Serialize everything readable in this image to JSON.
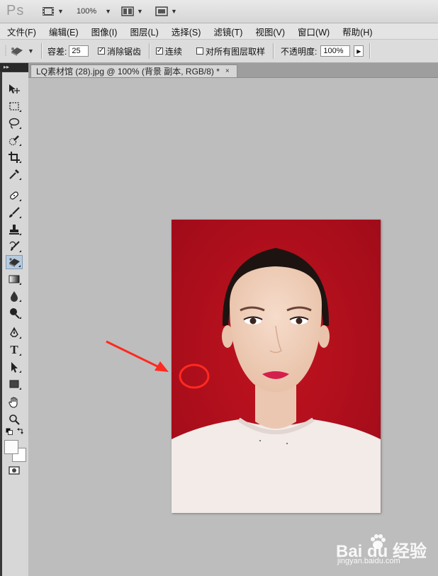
{
  "app": {
    "logo": "Ps",
    "zoom_label": "100%"
  },
  "menubar": {
    "items": [
      "文件(F)",
      "编辑(E)",
      "图像(I)",
      "图层(L)",
      "选择(S)",
      "滤镜(T)",
      "视图(V)",
      "窗口(W)",
      "帮助(H)"
    ]
  },
  "options": {
    "tolerance_label": "容差:",
    "tolerance_value": "25",
    "antialias_label": "消除锯齿",
    "antialias_checked": "✓",
    "contiguous_label": "连续",
    "contiguous_checked": "✓",
    "all_layers_label": "对所有图层取样",
    "opacity_label": "不透明度:",
    "opacity_value": "100%"
  },
  "document": {
    "tab_title": "LQ素材馆 (28).jpg @ 100% (背景 副本, RGB/8) *",
    "tab_close": "×"
  },
  "colors": {
    "annotation_red": "#ff2a1f",
    "photo_background": "#b00e1c",
    "active_tool_bg": "#b7cbe0"
  },
  "tools": [
    {
      "name": "move-tool-icon"
    },
    {
      "name": "marquee-tool-icon"
    },
    {
      "name": "lasso-tool-icon"
    },
    {
      "name": "quick-selection-tool-icon"
    },
    {
      "name": "crop-tool-icon"
    },
    {
      "name": "eyedropper-tool-icon"
    },
    {
      "name": "healing-brush-tool-icon"
    },
    {
      "name": "brush-tool-icon"
    },
    {
      "name": "clone-stamp-tool-icon"
    },
    {
      "name": "history-brush-tool-icon"
    },
    {
      "name": "background-eraser-tool-icon"
    },
    {
      "name": "gradient-tool-icon"
    },
    {
      "name": "blur-tool-icon"
    },
    {
      "name": "dodge-tool-icon"
    },
    {
      "name": "pen-tool-icon"
    },
    {
      "name": "type-tool-icon"
    },
    {
      "name": "path-selection-tool-icon"
    },
    {
      "name": "rectangle-tool-icon"
    },
    {
      "name": "hand-tool-icon"
    },
    {
      "name": "zoom-tool-icon"
    }
  ],
  "watermark": {
    "brand": "Bai du 经验",
    "url": "jingyan.baidu.com"
  }
}
